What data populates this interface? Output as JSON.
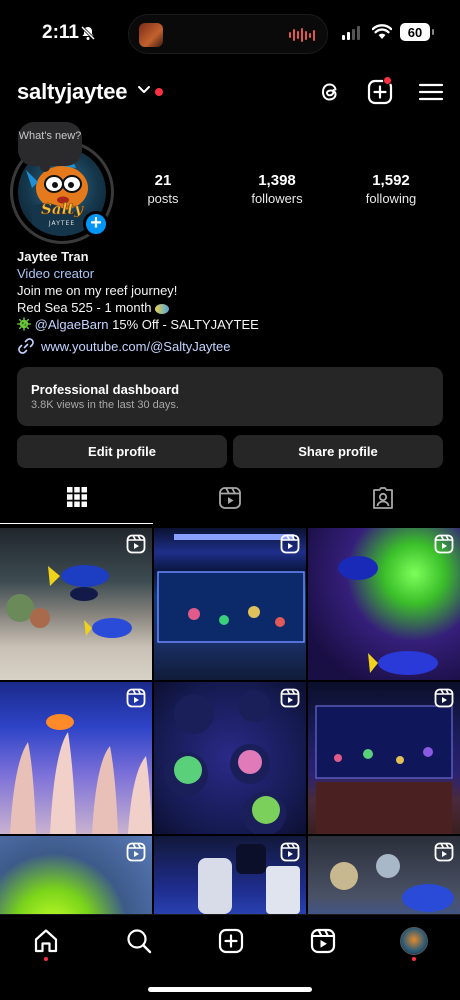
{
  "status_bar": {
    "time": "2:11",
    "battery": "60",
    "icons": [
      "bell-off-icon",
      "signal-icon",
      "wifi-icon",
      "battery-icon"
    ]
  },
  "header": {
    "username": "saltyjaytee",
    "icons": [
      "chevron-down-icon",
      "threads-icon",
      "create-icon",
      "menu-icon"
    ],
    "accent_color": "#ff3040"
  },
  "profile": {
    "note_placeholder": "What's new?",
    "stats": [
      {
        "num": "21",
        "label": "posts"
      },
      {
        "num": "1,398",
        "label": "followers"
      },
      {
        "num": "1,592",
        "label": "following"
      }
    ],
    "avatar_text": [
      "Salty",
      "JAYTEE"
    ]
  },
  "bio": {
    "name": "Jaytee Tran",
    "category": "Video creator",
    "line1": "Join me on my reef journey!",
    "line2": "Red Sea 525 - 1 month",
    "mention": "@AlgaeBarn",
    "mention_suffix": " 15% Off - SALTYJAYTEE",
    "link": "www.youtube.com/@SaltyJaytee",
    "link_color": "#c2d4ff"
  },
  "dashboard": {
    "title": "Professional dashboard",
    "subtitle": "3.8K views in the last 30 days."
  },
  "buttons": {
    "edit": "Edit profile",
    "share": "Share profile"
  },
  "tabs": [
    {
      "name": "grid-icon",
      "active": true
    },
    {
      "name": "reels-icon",
      "active": false
    },
    {
      "name": "tagged-icon",
      "active": false
    }
  ],
  "grid": {
    "tile_count": 9,
    "badge_icon": "reel-icon"
  },
  "bottom_nav": {
    "items": [
      "home-icon",
      "search-icon",
      "create-icon",
      "reels-icon",
      "profile-avatar"
    ]
  }
}
